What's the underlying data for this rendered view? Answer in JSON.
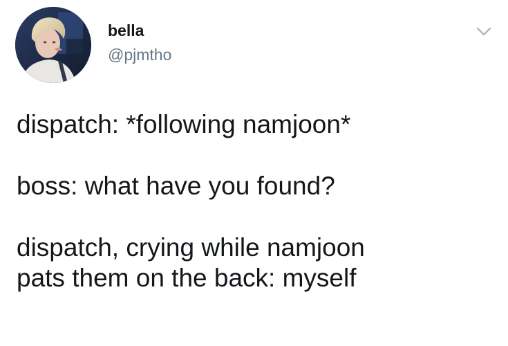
{
  "tweet": {
    "author": {
      "display_name": "bella",
      "handle": "@pjmtho",
      "avatar_icon": "profile-photo"
    },
    "menu_icon": "chevron-down-icon",
    "lines": {
      "line1": "dispatch: *following namjoon*",
      "line2": "boss: what have you found?",
      "line3": "dispatch, crying while namjoon",
      "line4": "pats them on the back: myself"
    }
  },
  "colors": {
    "background": "#ffffff",
    "text": "#14171a",
    "secondary_text": "#657786",
    "chevron": "#aab8c2"
  }
}
